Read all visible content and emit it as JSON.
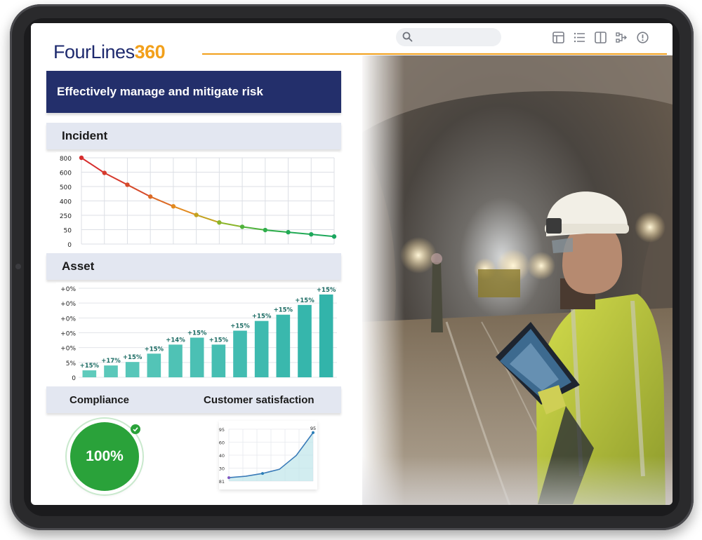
{
  "brand": {
    "logo_main": "FourLines",
    "logo_number": "360",
    "accent": "#f2a01b",
    "navy": "#232f6b"
  },
  "toolbar": {
    "search_placeholder": "",
    "icons": [
      "layout-grid-icon",
      "list-icon",
      "columns-icon",
      "flow-icon",
      "info-icon"
    ]
  },
  "banner": {
    "title": "Effectively manage and mitigate risk"
  },
  "incident": {
    "title": "Incident",
    "y_ticks": [
      "800",
      "600",
      "500",
      "400",
      "250",
      "50",
      "0"
    ]
  },
  "asset": {
    "title": "Asset",
    "y_ticks": [
      "+0%",
      "+0%",
      "+0%",
      "+0%",
      "+0%",
      "5%",
      "0"
    ]
  },
  "compliance": {
    "label": "Compliance",
    "value": "100%"
  },
  "customer_satisfaction": {
    "label": "Customer satisfaction",
    "y_ticks": [
      "95",
      "60",
      "40",
      "30",
      "81"
    ],
    "end_label": "95"
  },
  "chart_data": [
    {
      "type": "line",
      "name_ref": "Incident",
      "x": [
        1,
        2,
        3,
        4,
        5,
        6,
        7,
        8,
        9,
        10,
        11,
        12
      ],
      "values": [
        800,
        660,
        550,
        440,
        350,
        270,
        200,
        160,
        130,
        110,
        90,
        70
      ],
      "colors": [
        "#d62d2d",
        "#d63a2d",
        "#d64a2a",
        "#dc6a25",
        "#e28a20",
        "#c3a21f",
        "#8ab52a",
        "#4fb23b",
        "#2fae4c",
        "#22aa55",
        "#1ea85b",
        "#1aa65f"
      ]
    },
    {
      "type": "bar",
      "name_ref": "Asset",
      "categories": [
        "1",
        "2",
        "3",
        "4",
        "5",
        "6",
        "7",
        "8",
        "9",
        "10",
        "11",
        "12"
      ],
      "values": [
        10,
        17,
        22,
        34,
        47,
        57,
        47,
        67,
        81,
        90,
        104,
        119
      ],
      "data_labels": [
        "+15%",
        "+17%",
        "+15%",
        "+15%",
        "+14%",
        "+15%",
        "+15%",
        "+15%",
        "+15%",
        "+15%",
        "+15%",
        "+15%"
      ]
    },
    {
      "type": "line",
      "name_ref": "Customer satisfaction",
      "x": [
        1,
        2,
        3,
        4,
        5,
        6
      ],
      "values": [
        30,
        32,
        36,
        42,
        62,
        95
      ]
    }
  ]
}
